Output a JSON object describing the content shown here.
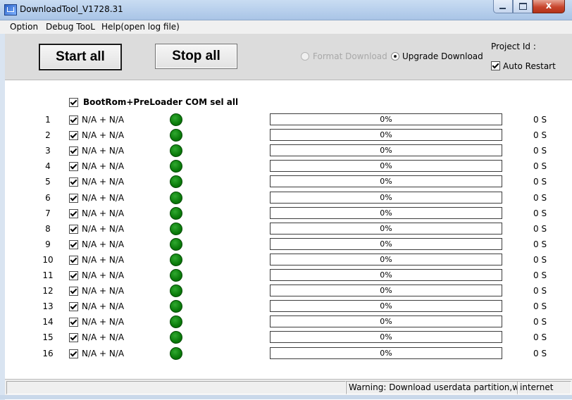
{
  "window": {
    "title": "DownloadTool_V1728.31",
    "close_glyph": "x"
  },
  "menu": {
    "items": [
      "Option",
      "Debug TooL",
      "Help(open log file)"
    ]
  },
  "toolbar": {
    "start_label": "Start all",
    "stop_label": "Stop all",
    "format_label": "Format Download",
    "upgrade_label": "Upgrade Download",
    "format_selected": false,
    "upgrade_selected": true,
    "project_id_label": "Project Id :",
    "auto_restart_label": "Auto Restart",
    "auto_restart_checked": true
  },
  "main": {
    "select_all_label": "BootRom+PreLoader COM sel all",
    "select_all_checked": true,
    "led_color": "#0a7a0a",
    "rows": [
      {
        "num": "1",
        "port": "N/A + N/A",
        "progress_text": "0%",
        "progress": 0,
        "time": "0 S"
      },
      {
        "num": "2",
        "port": "N/A + N/A",
        "progress_text": "0%",
        "progress": 0,
        "time": "0 S"
      },
      {
        "num": "3",
        "port": "N/A + N/A",
        "progress_text": "0%",
        "progress": 0,
        "time": "0 S"
      },
      {
        "num": "4",
        "port": "N/A + N/A",
        "progress_text": "0%",
        "progress": 0,
        "time": "0 S"
      },
      {
        "num": "5",
        "port": "N/A + N/A",
        "progress_text": "0%",
        "progress": 0,
        "time": "0 S"
      },
      {
        "num": "6",
        "port": "N/A + N/A",
        "progress_text": "0%",
        "progress": 0,
        "time": "0 S"
      },
      {
        "num": "7",
        "port": "N/A + N/A",
        "progress_text": "0%",
        "progress": 0,
        "time": "0 S"
      },
      {
        "num": "8",
        "port": "N/A + N/A",
        "progress_text": "0%",
        "progress": 0,
        "time": "0 S"
      },
      {
        "num": "9",
        "port": "N/A + N/A",
        "progress_text": "0%",
        "progress": 0,
        "time": "0 S"
      },
      {
        "num": "10",
        "port": "N/A + N/A",
        "progress_text": "0%",
        "progress": 0,
        "time": "0 S"
      },
      {
        "num": "11",
        "port": "N/A + N/A",
        "progress_text": "0%",
        "progress": 0,
        "time": "0 S"
      },
      {
        "num": "12",
        "port": "N/A + N/A",
        "progress_text": "0%",
        "progress": 0,
        "time": "0 S"
      },
      {
        "num": "13",
        "port": "N/A + N/A",
        "progress_text": "0%",
        "progress": 0,
        "time": "0 S"
      },
      {
        "num": "14",
        "port": "N/A + N/A",
        "progress_text": "0%",
        "progress": 0,
        "time": "0 S"
      },
      {
        "num": "15",
        "port": "N/A + N/A",
        "progress_text": "0%",
        "progress": 0,
        "time": "0 S"
      },
      {
        "num": "16",
        "port": "N/A + N/A",
        "progress_text": "0%",
        "progress": 0,
        "time": "0 S"
      }
    ]
  },
  "statusbar": {
    "warning": "Warning: Download userdata partition,will lo",
    "network": "internet"
  }
}
